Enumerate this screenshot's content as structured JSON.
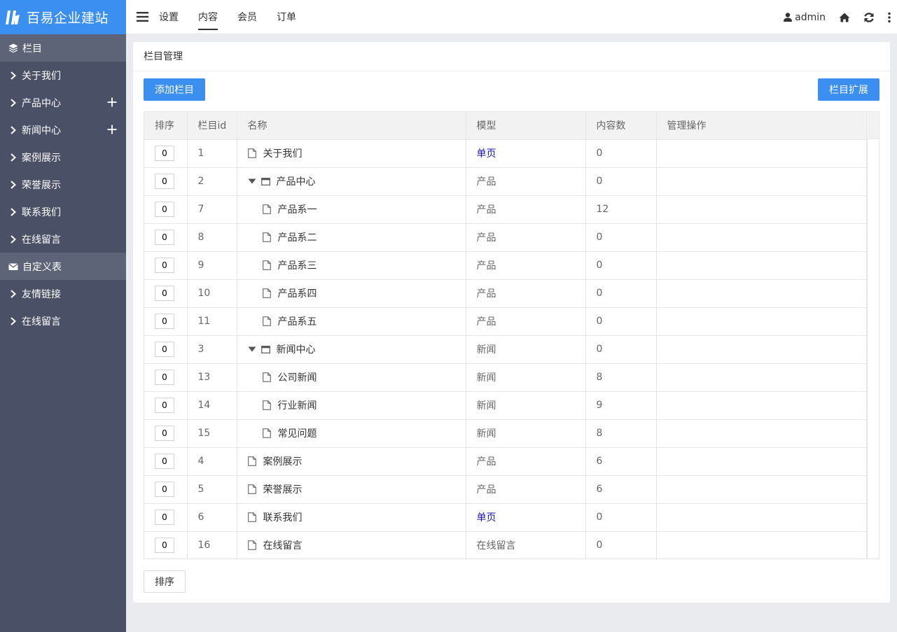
{
  "brand": {
    "title": "百易企业建站"
  },
  "sidebar": {
    "sections": [
      {
        "title": "栏目",
        "icon": "layers-icon",
        "items": [
          {
            "label": "关于我们",
            "expandable": false
          },
          {
            "label": "产品中心",
            "expandable": true
          },
          {
            "label": "新闻中心",
            "expandable": true
          },
          {
            "label": "案例展示",
            "expandable": false
          },
          {
            "label": "荣誉展示",
            "expandable": false
          },
          {
            "label": "联系我们",
            "expandable": false
          },
          {
            "label": "在线留言",
            "expandable": false
          }
        ]
      },
      {
        "title": "自定义表",
        "icon": "envelope-icon",
        "items": [
          {
            "label": "友情链接",
            "expandable": false
          },
          {
            "label": "在线留言",
            "expandable": false
          }
        ]
      }
    ]
  },
  "topnav": {
    "tabs": [
      {
        "label": "设置",
        "active": false
      },
      {
        "label": "内容",
        "active": true
      },
      {
        "label": "会员",
        "active": false
      },
      {
        "label": "订单",
        "active": false
      }
    ],
    "user": "admin"
  },
  "page": {
    "title": "栏目管理",
    "add_button": "添加栏目",
    "ext_button": "栏目扩展",
    "sort_button": "排序"
  },
  "table": {
    "headers": [
      "排序",
      "栏目id",
      "名称",
      "模型",
      "内容数",
      "管理操作"
    ],
    "rows": [
      {
        "sort": "0",
        "id": "1",
        "name": "关于我们",
        "level": 1,
        "parent": false,
        "model": "单页",
        "model_link": true,
        "count": "0"
      },
      {
        "sort": "0",
        "id": "2",
        "name": "产品中心",
        "level": 1,
        "parent": true,
        "model": "产品",
        "model_link": false,
        "count": "0"
      },
      {
        "sort": "0",
        "id": "7",
        "name": "产品系一",
        "level": 2,
        "parent": false,
        "model": "产品",
        "model_link": false,
        "count": "12"
      },
      {
        "sort": "0",
        "id": "8",
        "name": "产品系二",
        "level": 2,
        "parent": false,
        "model": "产品",
        "model_link": false,
        "count": "0"
      },
      {
        "sort": "0",
        "id": "9",
        "name": "产品系三",
        "level": 2,
        "parent": false,
        "model": "产品",
        "model_link": false,
        "count": "0"
      },
      {
        "sort": "0",
        "id": "10",
        "name": "产品系四",
        "level": 2,
        "parent": false,
        "model": "产品",
        "model_link": false,
        "count": "0"
      },
      {
        "sort": "0",
        "id": "11",
        "name": "产品系五",
        "level": 2,
        "parent": false,
        "model": "产品",
        "model_link": false,
        "count": "0"
      },
      {
        "sort": "0",
        "id": "3",
        "name": "新闻中心",
        "level": 1,
        "parent": true,
        "model": "新闻",
        "model_link": false,
        "count": "0"
      },
      {
        "sort": "0",
        "id": "13",
        "name": "公司新闻",
        "level": 2,
        "parent": false,
        "model": "新闻",
        "model_link": false,
        "count": "8"
      },
      {
        "sort": "0",
        "id": "14",
        "name": "行业新闻",
        "level": 2,
        "parent": false,
        "model": "新闻",
        "model_link": false,
        "count": "9"
      },
      {
        "sort": "0",
        "id": "15",
        "name": "常见问题",
        "level": 2,
        "parent": false,
        "model": "新闻",
        "model_link": false,
        "count": "8"
      },
      {
        "sort": "0",
        "id": "4",
        "name": "案例展示",
        "level": 1,
        "parent": false,
        "model": "产品",
        "model_link": false,
        "count": "6"
      },
      {
        "sort": "0",
        "id": "5",
        "name": "荣誉展示",
        "level": 1,
        "parent": false,
        "model": "产品",
        "model_link": false,
        "count": "6"
      },
      {
        "sort": "0",
        "id": "6",
        "name": "联系我们",
        "level": 1,
        "parent": false,
        "model": "单页",
        "model_link": true,
        "count": "0"
      },
      {
        "sort": "0",
        "id": "16",
        "name": "在线留言",
        "level": 1,
        "parent": false,
        "model": "在线留言",
        "model_link": false,
        "count": "0"
      }
    ]
  },
  "colors": {
    "brand": "#3b8ff1",
    "sidebar": "#4a5166",
    "section": "#5d6478",
    "link": "#1a1aa6"
  }
}
